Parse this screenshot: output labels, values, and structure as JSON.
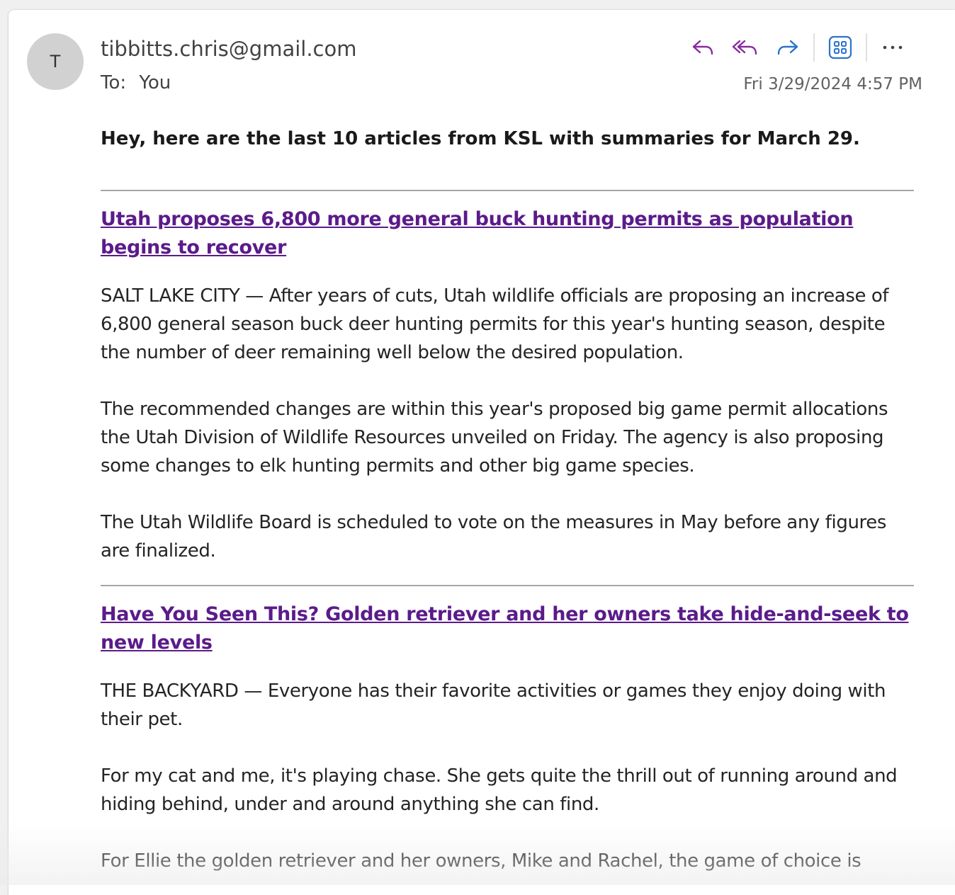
{
  "message": {
    "avatar_initial": "T",
    "sender": "tibbitts.chris@gmail.com",
    "to_label": "To:",
    "to_value": "You",
    "date": "Fri 3/29/2024 4:57 PM"
  },
  "toolbar": {
    "reply_icon": "reply-icon",
    "reply_all_icon": "reply-all-icon",
    "forward_icon": "forward-icon",
    "apps_icon": "apps-icon",
    "more_icon": "more-icon",
    "accent_purple": "#8a2a9e",
    "accent_blue": "#2b73c8"
  },
  "content": {
    "intro": "Hey, here are the last 10 articles from KSL with summaries for March 29.",
    "articles": [
      {
        "title": "Utah proposes 6,800 more general buck hunting permits as population begins to recover",
        "paragraphs": [
          "SALT LAKE CITY — After years of cuts, Utah wildlife officials are proposing an increase of 6,800 general season buck deer hunting permits for this year's hunting season, despite the number of deer remaining well below the desired population.",
          "The recommended changes are within this year's proposed big game permit allocations the Utah Division of Wildlife Resources unveiled on Friday. The agency is also proposing some changes to elk hunting permits and other big game species.",
          "The Utah Wildlife Board is scheduled to vote on the measures in May before any figures are finalized."
        ]
      },
      {
        "title": "Have You Seen This? Golden retriever and her owners take hide-and-seek to new levels",
        "paragraphs": [
          "THE BACKYARD — Everyone has their favorite activities or games they enjoy doing with their pet.",
          "For my cat and me, it's playing chase. She gets quite the thrill out of running around and hiding behind, under and around anything she can find.",
          "For Ellie the golden retriever and her owners, Mike and Rachel, the game of choice is"
        ]
      }
    ]
  }
}
